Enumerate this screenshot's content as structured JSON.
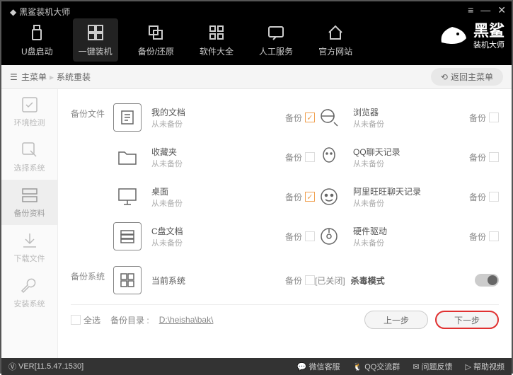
{
  "app": {
    "title": "黑鲨装机大师"
  },
  "brand": {
    "name": "黑鲨",
    "sub": "装机大师"
  },
  "nav": [
    {
      "label": "U盘启动"
    },
    {
      "label": "一键装机"
    },
    {
      "label": "备份/还原"
    },
    {
      "label": "软件大全"
    },
    {
      "label": "人工服务"
    },
    {
      "label": "官方网站"
    }
  ],
  "breadcrumb": {
    "home": "主菜单",
    "current": "系统重装",
    "return": "返回主菜单"
  },
  "sidebar": [
    {
      "label": "环境检测"
    },
    {
      "label": "选择系统"
    },
    {
      "label": "备份资料"
    },
    {
      "label": "下载文件"
    },
    {
      "label": "安装系统"
    }
  ],
  "sections": {
    "files": {
      "title": "备份文件",
      "items": [
        {
          "name": "我的文档",
          "sub": "从未备份",
          "chk_label": "备份",
          "checked": true
        },
        {
          "name": "浏览器",
          "sub": "从未备份",
          "chk_label": "备份",
          "checked": false
        },
        {
          "name": "收藏夹",
          "sub": "从未备份",
          "chk_label": "备份",
          "checked": false
        },
        {
          "name": "QQ聊天记录",
          "sub": "从未备份",
          "chk_label": "备份",
          "checked": false
        },
        {
          "name": "桌面",
          "sub": "从未备份",
          "chk_label": "备份",
          "checked": true
        },
        {
          "name": "阿里旺旺聊天记录",
          "sub": "从未备份",
          "chk_label": "备份",
          "checked": false
        },
        {
          "name": "C盘文档",
          "sub": "从未备份",
          "chk_label": "备份",
          "checked": false
        },
        {
          "name": "硬件驱动",
          "sub": "从未备份",
          "chk_label": "备份",
          "checked": false
        }
      ]
    },
    "system": {
      "title": "备份系统",
      "item": {
        "name": "当前系统",
        "chk_label": "备份",
        "checked": false
      },
      "kill": {
        "status": "[已关闭]",
        "label": "杀毒模式"
      }
    }
  },
  "bottom": {
    "select_all": "全选",
    "path_label": "备份目录 :",
    "path": "D:\\heisha\\bak\\",
    "prev": "上一步",
    "next": "下一步"
  },
  "footer": {
    "version": "VER[11.5.47.1530]",
    "links": [
      "微信客服",
      "QQ交流群",
      "问题反馈",
      "帮助视频"
    ]
  }
}
